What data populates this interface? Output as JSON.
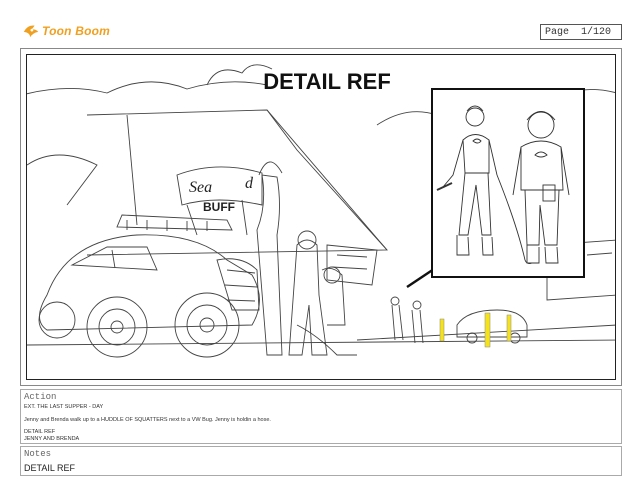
{
  "header": {
    "logo_text": "Toon Boom",
    "page_label": "Page",
    "page_value": "1/120"
  },
  "panel": {
    "title": "DETAIL REF",
    "sign_line1": "Sea",
    "sign_line2": "d",
    "sign_line3": "BUFF"
  },
  "action": {
    "label": "Action",
    "scene": "EXT. THE LAST SUPPER - DAY",
    "description": "Jenny and Brenda walk up to a HUDDLE OF SQUATTERS next to a VW Bug. Jenny is holdin a hose.",
    "note1": "DETAIL REF",
    "note2": "JENNY AND BRENDA"
  },
  "notes": {
    "label": "Notes",
    "text": "DETAIL REF"
  },
  "colors": {
    "logo": "#f0a020",
    "marker_yellow": "#f5e21a"
  },
  "icons": [
    "toon-boom-logo-icon"
  ]
}
